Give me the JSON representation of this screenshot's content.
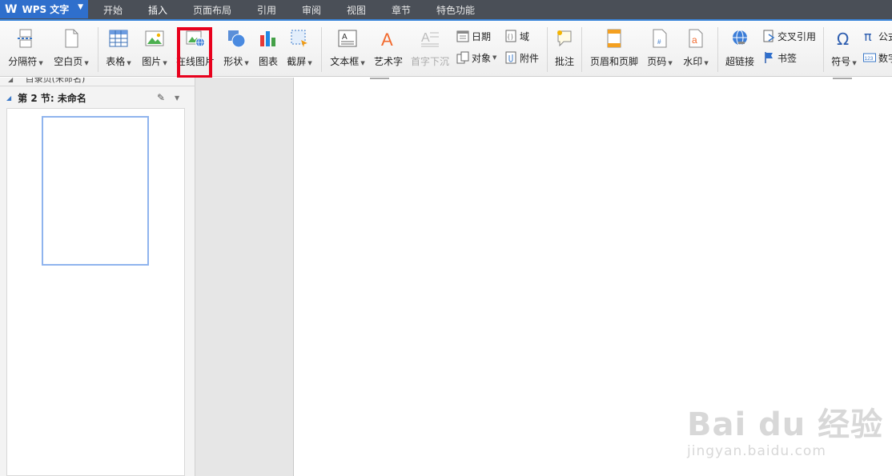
{
  "app": {
    "title": "WPS 文字"
  },
  "menu_tabs": [
    "开始",
    "插入",
    "页面布局",
    "引用",
    "审阅",
    "视图",
    "章节",
    "特色功能"
  ],
  "active_tab": "插入",
  "ribbon": {
    "page_break": "分隔符",
    "blank_page": "空白页",
    "table": "表格",
    "picture": "图片",
    "online_picture": "在线图片",
    "shape": "形状",
    "chart": "图表",
    "screenshot": "截屏",
    "textbox": "文本框",
    "wordart": "艺术字",
    "drop_cap": "首字下沉",
    "date": "日期",
    "object": "对象",
    "field": "域",
    "attachment": "附件",
    "comment": "批注",
    "header_footer": "页眉和页脚",
    "page_number": "页码",
    "watermark": "水印",
    "hyperlink": "超链接",
    "cross_reference": "交叉引用",
    "bookmark": "书签",
    "symbol": "符号",
    "formula": "公式",
    "number": "数字"
  },
  "nav": {
    "top_cut": "目录页(未命名)",
    "section_label": "第 2 节: 未命名"
  },
  "watermark": {
    "logo": "Bai du 经验",
    "url": "jingyan.baidu.com"
  },
  "colors": {
    "accent": "#2f6fcc",
    "highlight": "#e8001c",
    "topbar": "#4a4f57"
  }
}
